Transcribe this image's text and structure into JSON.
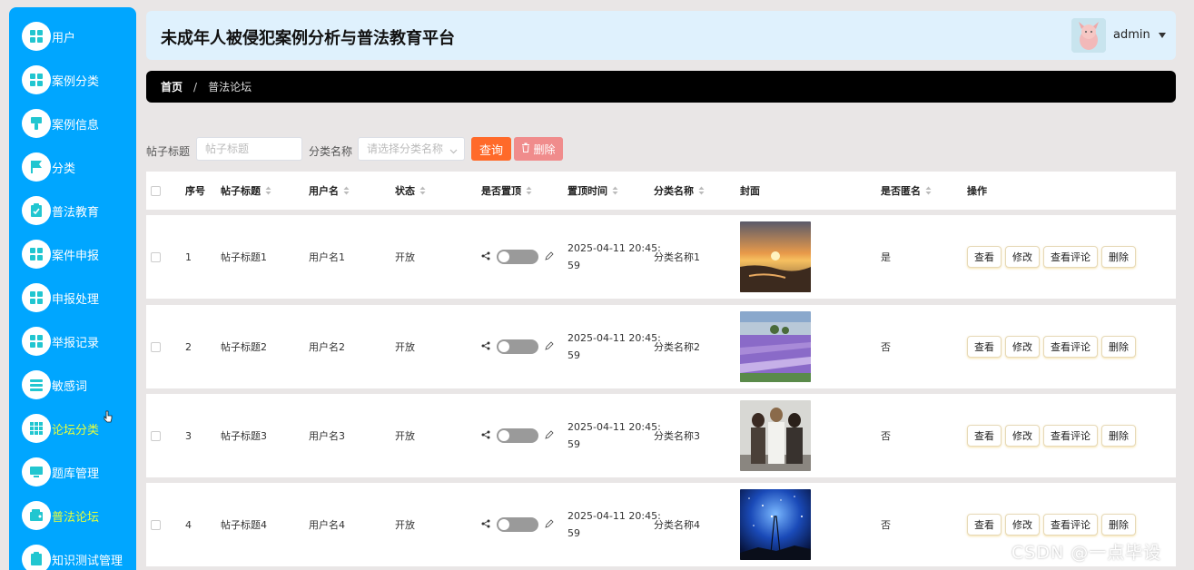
{
  "sidebar": {
    "items": [
      {
        "label": "用户",
        "icon": "grid-icon"
      },
      {
        "label": "案例分类",
        "icon": "grid-icon"
      },
      {
        "label": "案例信息",
        "icon": "brush-icon"
      },
      {
        "label": "分类",
        "icon": "flag-icon"
      },
      {
        "label": "普法教育",
        "icon": "clipboard-check-icon"
      },
      {
        "label": "案件申报",
        "icon": "grid-icon"
      },
      {
        "label": "申报处理",
        "icon": "grid-icon"
      },
      {
        "label": "举报记录",
        "icon": "grid-icon"
      },
      {
        "label": "敏感词",
        "icon": "list-icon"
      },
      {
        "label": "论坛分类",
        "icon": "apps-icon"
      },
      {
        "label": "题库管理",
        "icon": "monitor-icon"
      },
      {
        "label": "普法论坛",
        "icon": "wallet-icon"
      },
      {
        "label": "知识测试管理",
        "icon": "clipboard-icon"
      }
    ],
    "colors": {
      "background": "#00a6ff",
      "highlight_text": "#e8ff3a"
    }
  },
  "header": {
    "title": "未成年人被侵犯案例分析与普法教育平台",
    "user": "admin"
  },
  "breadcrumb": {
    "home": "首页",
    "separator": "/",
    "current": "普法论坛"
  },
  "search": {
    "title_label": "帖子标题",
    "title_placeholder": "帖子标题",
    "category_label": "分类名称",
    "category_placeholder": "请选择分类名称",
    "search_button": "查询",
    "delete_button": "删除"
  },
  "table": {
    "columns": [
      "序号",
      "帖子标题",
      "用户名",
      "状态",
      "是否置顶",
      "置顶时间",
      "分类名称",
      "封面",
      "是否匿名",
      "操作"
    ],
    "rows": [
      {
        "index": "1",
        "title": "帖子标题1",
        "username": "用户名1",
        "status": "开放",
        "pinned": false,
        "time_line1": "2025-04-11 20:45:",
        "time_line2": "59",
        "category": "分类名称1",
        "cover": "sunset-beach",
        "anonymous": "是"
      },
      {
        "index": "2",
        "title": "帖子标题2",
        "username": "用户名2",
        "status": "开放",
        "pinned": false,
        "time_line1": "2025-04-11 20:45:",
        "time_line2": "59",
        "category": "分类名称2",
        "cover": "lavender-field",
        "anonymous": "否"
      },
      {
        "index": "3",
        "title": "帖子标题3",
        "username": "用户名3",
        "status": "开放",
        "pinned": false,
        "time_line1": "2025-04-11 20:45:",
        "time_line2": "59",
        "category": "分类名称3",
        "cover": "movie-poster",
        "anonymous": "否"
      },
      {
        "index": "4",
        "title": "帖子标题4",
        "username": "用户名4",
        "status": "开放",
        "pinned": false,
        "time_line1": "2025-04-11 20:45:",
        "time_line2": "59",
        "category": "分类名称4",
        "cover": "starry-sky",
        "anonymous": "否"
      }
    ],
    "actions": [
      "查看",
      "修改",
      "查看评论",
      "删除"
    ]
  },
  "watermark": "CSDN @一点毕设"
}
